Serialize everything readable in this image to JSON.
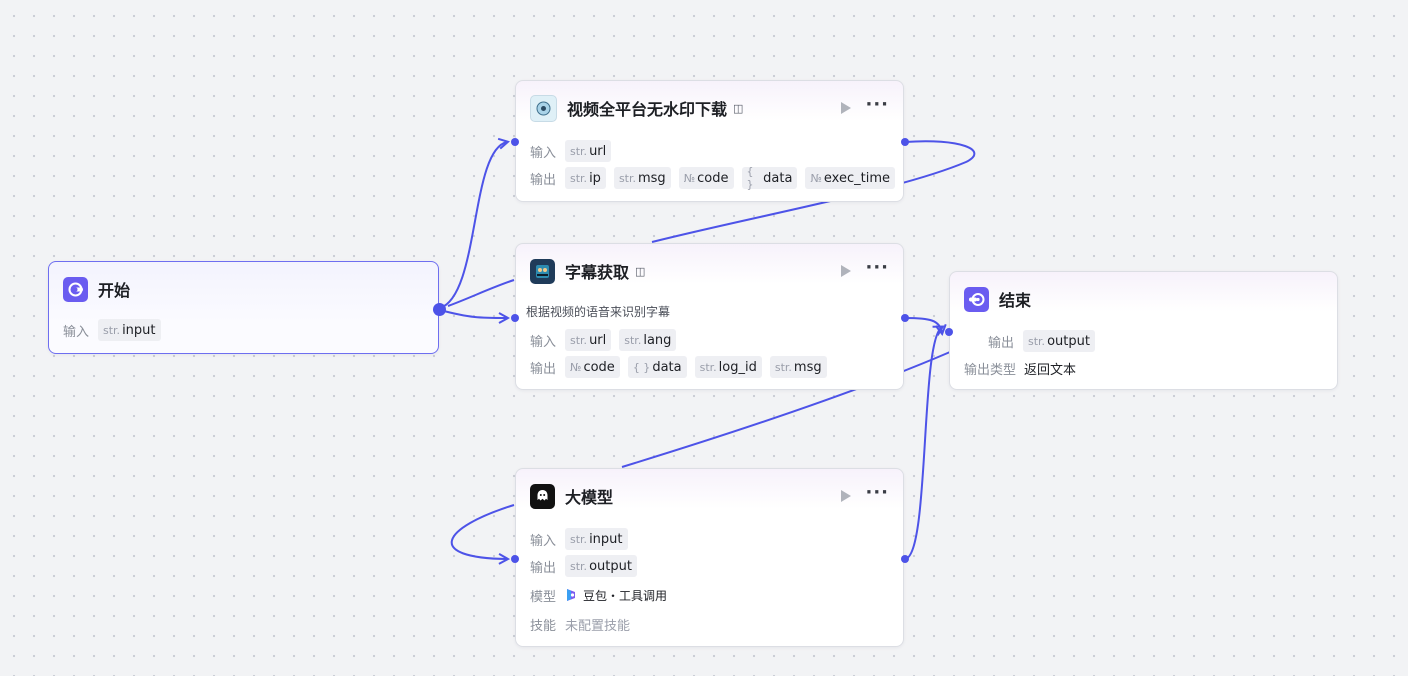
{
  "canvas": {
    "accent": "#4d53e8"
  },
  "nodes": {
    "start": {
      "title": "开始",
      "icon": "start-node-icon",
      "input_label": "输入",
      "inputs": [
        {
          "type": "str.",
          "name": "input"
        }
      ]
    },
    "video": {
      "title": "视频全平台无水印下载",
      "icon": "video-downloader-icon",
      "input_label": "输入",
      "output_label": "输出",
      "inputs": [
        {
          "type": "str.",
          "name": "url"
        }
      ],
      "outputs": [
        {
          "type": "str.",
          "name": "ip"
        },
        {
          "type": "str.",
          "name": "msg"
        },
        {
          "type": "№",
          "name": "code"
        },
        {
          "type": "{ }",
          "name": "data"
        },
        {
          "type": "№",
          "name": "exec_time"
        }
      ]
    },
    "subtitle": {
      "title": "字幕获取",
      "icon": "subtitle-plugin-icon",
      "description": "根据视频的语音来识别字幕",
      "input_label": "输入",
      "output_label": "输出",
      "inputs": [
        {
          "type": "str.",
          "name": "url"
        },
        {
          "type": "str.",
          "name": "lang"
        }
      ],
      "outputs": [
        {
          "type": "№",
          "name": "code"
        },
        {
          "type": "{ }",
          "name": "data"
        },
        {
          "type": "str.",
          "name": "log_id"
        },
        {
          "type": "str.",
          "name": "msg"
        }
      ]
    },
    "llm": {
      "title": "大模型",
      "icon": "llm-ghost-icon",
      "input_label": "输入",
      "output_label": "输出",
      "model_label": "模型",
      "skills_label": "技能",
      "inputs": [
        {
          "type": "str.",
          "name": "input"
        }
      ],
      "outputs": [
        {
          "type": "str.",
          "name": "output"
        }
      ],
      "model_value": "豆包・工具调用",
      "skills_value": "未配置技能"
    },
    "end": {
      "title": "结束",
      "icon": "end-node-icon",
      "output_label": "输出",
      "outputs": [
        {
          "type": "str.",
          "name": "output"
        }
      ],
      "output_type_label": "输出类型",
      "output_type_value": "返回文本"
    }
  }
}
